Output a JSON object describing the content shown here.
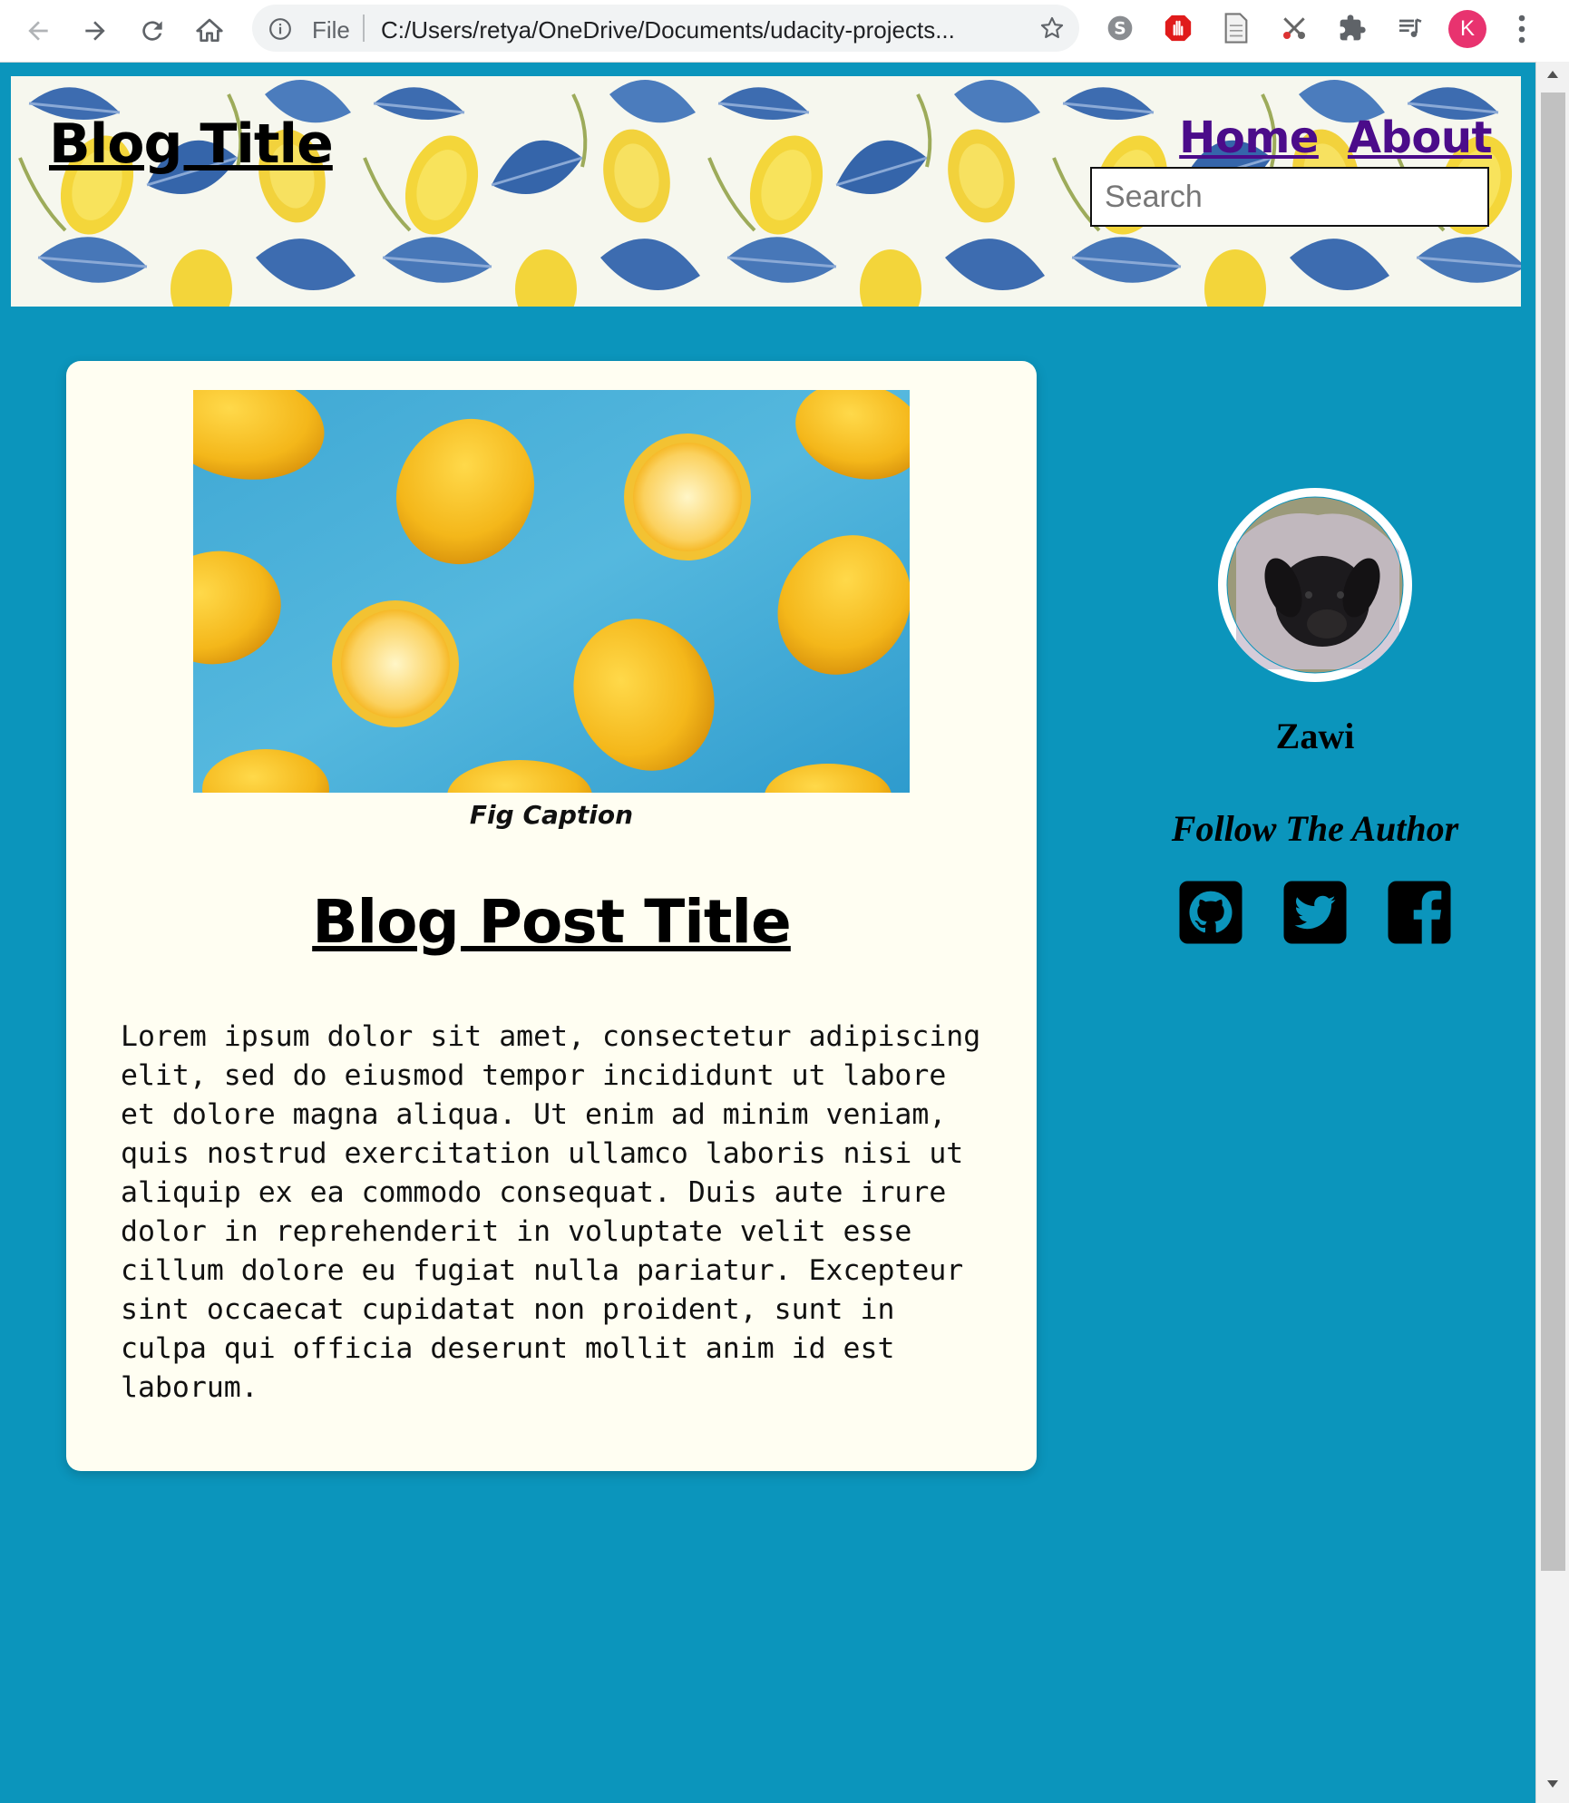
{
  "browser": {
    "file_label": "File",
    "url": "C:/Users/retya/OneDrive/Documents/udacity-projects...",
    "profile_initial": "K"
  },
  "header": {
    "blog_title": "Blog Title",
    "nav": [
      {
        "label": "Home",
        "icon": null
      },
      {
        "label": "About",
        "icon": null
      }
    ],
    "search": {
      "placeholder": "Search",
      "value": ""
    }
  },
  "post": {
    "fig_caption": "Fig Caption",
    "title": "Blog Post Title",
    "body": "Lorem ipsum dolor sit amet, consectetur adipiscing elit, sed do eiusmod tempor incididunt ut labore et dolore magna aliqua. Ut enim ad minim veniam, quis nostrud exercitation ullamco laboris nisi ut aliquip ex ea commodo consequat. Duis aute irure dolor in reprehenderit in voluptate velit esse cillum dolore eu fugiat nulla pariatur. Excepteur sint occaecat cupidatat non proident, sunt in culpa qui officia deserunt mollit anim id est laborum."
  },
  "sidebar": {
    "author_name": "Zawi",
    "follow_label": "Follow The Author",
    "social": [
      {
        "icon": "github-icon"
      },
      {
        "icon": "twitter-icon"
      },
      {
        "icon": "facebook-icon"
      }
    ]
  },
  "colors": {
    "page_background": "#0b95bc",
    "card_background": "#fffef2",
    "nav_link": "#4b0c8a",
    "profile_badge": "#e8336f"
  }
}
